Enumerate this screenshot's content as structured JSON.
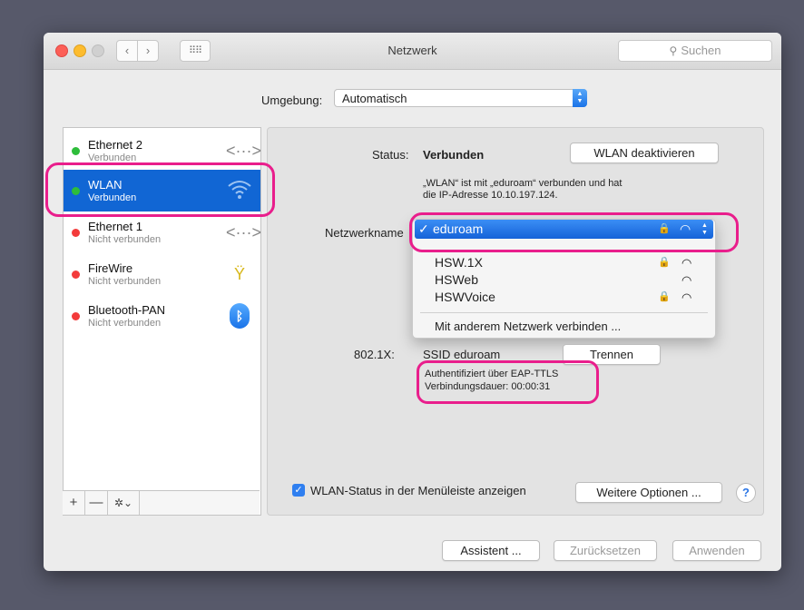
{
  "window": {
    "title": "Netzwerk"
  },
  "search": {
    "placeholder": "Suchen",
    "icon": "magnifier-icon"
  },
  "location": {
    "label": "Umgebung:",
    "value": "Automatisch"
  },
  "services": [
    {
      "name": "Ethernet 2",
      "status": "Verbunden",
      "dot": "#2ebd3b",
      "icon": "ethernet-icon"
    },
    {
      "name": "WLAN",
      "status": "Verbunden",
      "dot": "#2ebd3b",
      "icon": "wifi-icon",
      "selected": true
    },
    {
      "name": "Ethernet 1",
      "status": "Nicht verbunden",
      "dot": "#f33b3b",
      "icon": "ethernet-icon"
    },
    {
      "name": "FireWire",
      "status": "Nicht verbunden",
      "dot": "#f33b3b",
      "icon": "firewire-icon"
    },
    {
      "name": "Bluetooth-PAN",
      "status": "Nicht verbunden",
      "dot": "#f33b3b",
      "icon": "bluetooth-icon"
    }
  ],
  "sidebar_tools": {
    "add": "+",
    "remove": "—",
    "gear": "✲⌄"
  },
  "status": {
    "label": "Status:",
    "value": "Verbunden",
    "toggle_button": "WLAN deaktivieren",
    "description_line1": "„WLAN“ ist mit „eduroam“ verbunden und hat",
    "description_line2": "die IP-Adresse 10.10.197.124."
  },
  "network_name": {
    "label": "Netzwerkname",
    "selected": "eduroam",
    "options": [
      {
        "name": "HSW.1X",
        "locked": true
      },
      {
        "name": "HSWeb",
        "locked": false
      },
      {
        "name": "HSWVoice",
        "locked": true
      }
    ],
    "other": "Mit anderem Netzwerk verbinden ..."
  },
  "dot1x": {
    "label": "802.1X:",
    "value": "SSID eduroam",
    "disconnect_button": "Trennen",
    "auth": "Authentifiziert über EAP-TTLS",
    "duration": "Verbindungsdauer: 00:00:31"
  },
  "menu_status": {
    "label": "WLAN-Status in der Menüleiste anzeigen",
    "checked": true
  },
  "more_options": "Weitere Optionen ...",
  "help": "?",
  "footer": {
    "assistant": "Assistent ...",
    "reset": "Zurücksetzen",
    "apply": "Anwenden"
  },
  "colors": {
    "accent": "#1166d4",
    "annotation": "#e91e8c"
  }
}
